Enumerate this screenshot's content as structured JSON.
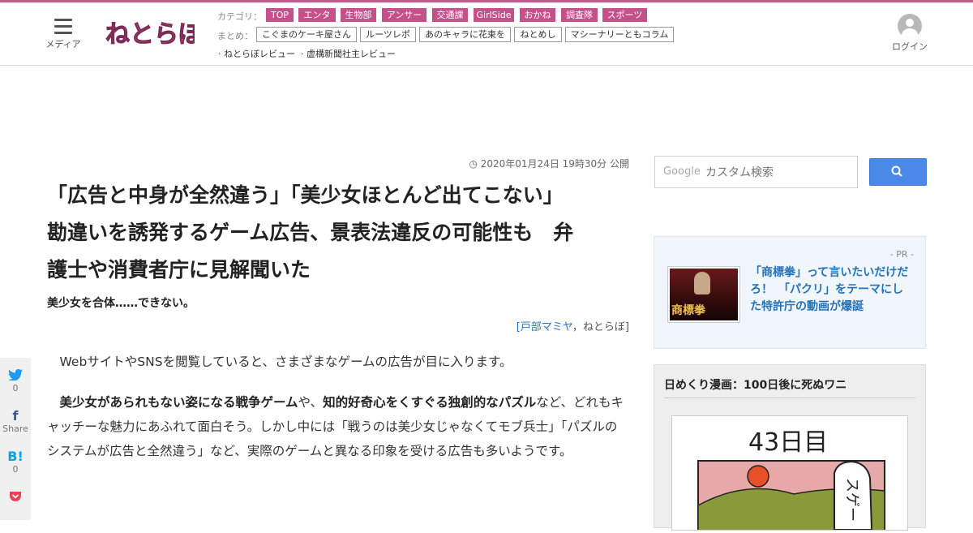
{
  "header": {
    "menu_label": "メディア",
    "logo_text": "ねとらぼ",
    "category_label": "カテゴリ：",
    "categories": [
      "TOP",
      "エンタ",
      "生物部",
      "アンサー",
      "交通課",
      "GirlSide",
      "おかね",
      "調査隊",
      "スポーツ"
    ],
    "summary_label": "まとめ：",
    "summaries": [
      "こぐまのケーキ屋さん",
      "ルーツレポ",
      "あのキャラに花束を",
      "ねとめし",
      "マシーナリーともコラム"
    ],
    "reviews": [
      "· ねとらぼレビュー",
      "· 虚構新聞社主レビュー"
    ],
    "login_label": "ログイン",
    "accent_color": "#c6508a"
  },
  "article": {
    "date": "2020年01月24日 19時30分 公開",
    "title_line1": "「広告と中身が全然違う」「美少女ほとんど出てこない」",
    "title_line2": "勘違いを誘発するゲーム広告、景表法違反の可能性も　弁",
    "title_line3": "護士や消費者庁に見解聞いた",
    "subtitle": "美少女を合体……できない。",
    "byline_open": "[",
    "author": "戸部マミヤ",
    "byline_sep": "，",
    "outlet": "ねとらぼ",
    "byline_close": "]",
    "p1": "WebサイトやSNSを閲覧していると、さまざまなゲームの広告が目に入ります。",
    "p2_bold1": "美少女があられもない姿になる戦争ゲーム",
    "p2_mid": "や、",
    "p2_bold2": "知的好奇心をくすぐる独創的なパズル",
    "p2_rest": "など、どれもキャッチーな魅力にあふれて面白そう。しかし中には「戦うのは美少女じゃなくてモブ兵士」「パズルのシステムが広告と全然違う」など、実際のゲームと異なる印象を受ける広告も多いようです。"
  },
  "share": {
    "twitter_count": "0",
    "facebook_label": "Share",
    "hatena_count": "0"
  },
  "sidebar": {
    "search_brand": "Google",
    "search_placeholder": "カスタム検索",
    "pr_tag": "- PR -",
    "pr_thumb_text": "商標拳",
    "pr_text": "「商標拳」って言いたいだけだろ！　「パクリ」をテーマにした特許庁の動画が爆誕",
    "manga_title": "日めくり漫画：100日後に死ぬワニ",
    "manga_day": "43日目",
    "manga_speech": "スゲー"
  }
}
